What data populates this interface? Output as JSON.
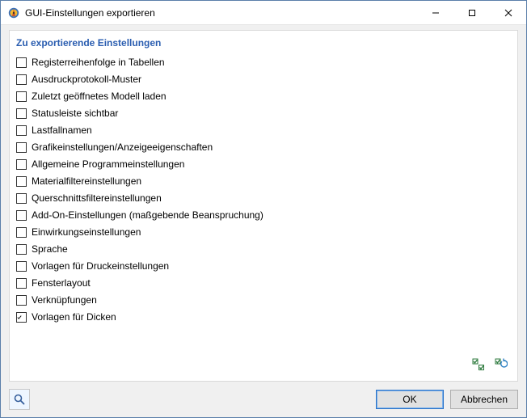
{
  "window": {
    "title": "GUI-Einstellungen exportieren"
  },
  "section": {
    "title": "Zu exportierende Einstellungen"
  },
  "settings": [
    {
      "label": "Registerreihenfolge in Tabellen",
      "checked": false
    },
    {
      "label": "Ausdruckprotokoll-Muster",
      "checked": false
    },
    {
      "label": "Zuletzt geöffnetes Modell laden",
      "checked": false
    },
    {
      "label": "Statusleiste sichtbar",
      "checked": false
    },
    {
      "label": "Lastfallnamen",
      "checked": false
    },
    {
      "label": "Grafikeinstellungen/Anzeigeeigenschaften",
      "checked": false
    },
    {
      "label": "Allgemeine Programmeinstellungen",
      "checked": false
    },
    {
      "label": "Materialfiltereinstellungen",
      "checked": false
    },
    {
      "label": "Querschnittsfiltereinstellungen",
      "checked": false
    },
    {
      "label": "Add-On-Einstellungen (maßgebende Beanspruchung)",
      "checked": false
    },
    {
      "label": "Einwirkungseinstellungen",
      "checked": false
    },
    {
      "label": "Sprache",
      "checked": false
    },
    {
      "label": "Vorlagen für Druckeinstellungen",
      "checked": false
    },
    {
      "label": "Fensterlayout",
      "checked": false
    },
    {
      "label": "Verknüpfungen",
      "checked": false
    },
    {
      "label": "Vorlagen für Dicken",
      "checked": true
    }
  ],
  "buttons": {
    "ok": "OK",
    "cancel": "Abbrechen"
  },
  "icons": {
    "select_all": "select-all-icon",
    "deselect_all": "deselect-all-icon",
    "help": "help-icon"
  }
}
